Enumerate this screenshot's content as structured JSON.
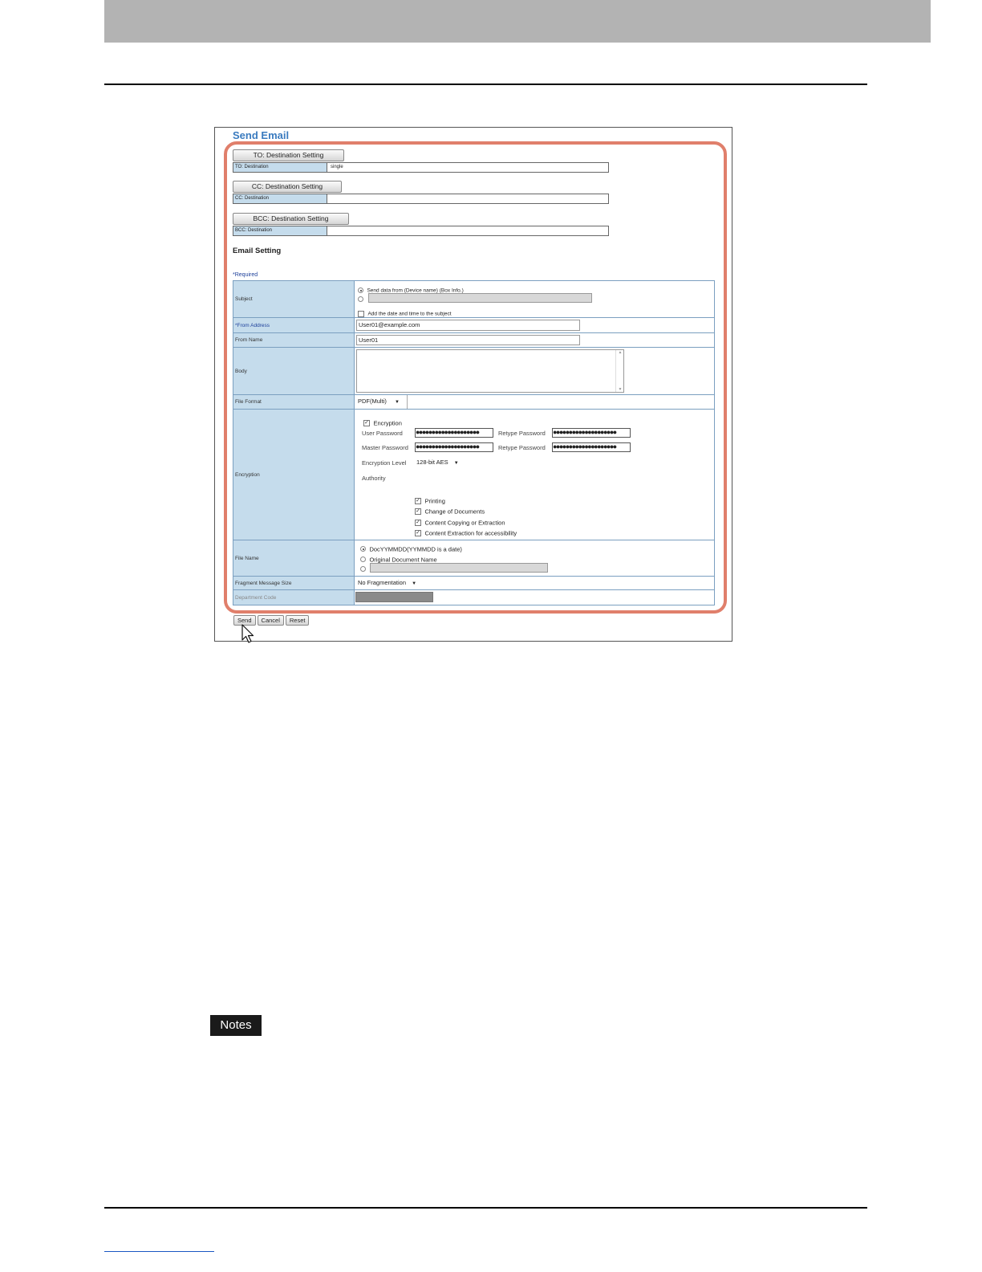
{
  "panel": {
    "title": "Send Email"
  },
  "destinations": {
    "to_button": "TO: Destination Setting",
    "to_label": "TO: Destination",
    "to_value": "single",
    "cc_button": "CC: Destination Setting",
    "cc_label": "CC: Destination",
    "cc_value": "",
    "bcc_button": "BCC: Destination Setting",
    "bcc_label": "BCC: Destination",
    "bcc_value": ""
  },
  "email_setting": {
    "title": "Email Setting",
    "required_note": "*Required",
    "subject": {
      "label": "Subject",
      "option_default": "Send data from (Device name) (Box Info.)",
      "custom_value": "",
      "add_datetime": "Add the date and time to the subject"
    },
    "from_address": {
      "label": "*From Address",
      "value": "User01@example.com"
    },
    "from_name": {
      "label": "From Name",
      "value": "User01"
    },
    "body": {
      "label": "Body",
      "value": ""
    },
    "file_format": {
      "label": "File Format",
      "value": "PDF(Multi)"
    },
    "encryption": {
      "label": "Encryption",
      "checkbox_label": "Encryption",
      "user_password_label": "User Password",
      "user_password_value": "●●●●●●●●●●●●●●●●●●●●",
      "retype_label_1": "Retype Password",
      "retype_value_1": "●●●●●●●●●●●●●●●●●●●●",
      "master_password_label": "Master Password",
      "master_password_value": "●●●●●●●●●●●●●●●●●●●●",
      "retype_label_2": "Retype Password",
      "retype_value_2": "●●●●●●●●●●●●●●●●●●●●",
      "level_label": "Encryption Level",
      "level_value": "128-bit AES",
      "authority_label": "Authority",
      "authority": [
        "Printing",
        "Change of Documents",
        "Content Copying or Extraction",
        "Content Extraction for accessibility"
      ]
    },
    "file_name": {
      "label": "File Name",
      "option_1": "DocYYMMDD(YYMMDD is a date)",
      "option_2": "Original Document Name",
      "custom_value": ""
    },
    "fragment": {
      "label": "Fragment Message Size",
      "value": "No Fragmentation"
    },
    "department": {
      "label": "Department Code",
      "value": ""
    }
  },
  "actions": {
    "send": "Send",
    "cancel": "Cancel",
    "reset": "Reset"
  },
  "notes_label": "Notes",
  "colors": {
    "highlight": "#e07f6b",
    "label_bg": "#c5dcec",
    "title": "#3a7bbf"
  }
}
